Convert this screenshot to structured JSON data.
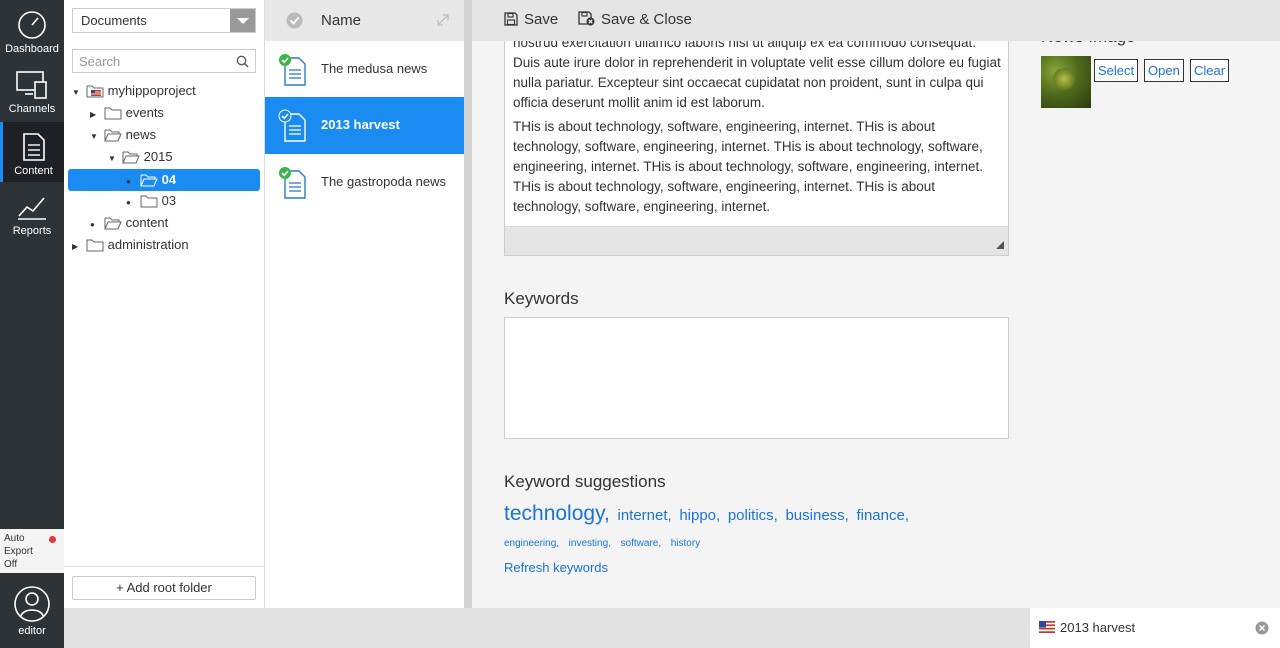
{
  "nav": {
    "items": [
      {
        "label": "Dashboard",
        "icon": "dashboard-icon"
      },
      {
        "label": "Channels",
        "icon": "channels-icon"
      },
      {
        "label": "Content",
        "icon": "content-icon",
        "active": true
      },
      {
        "label": "Reports",
        "icon": "reports-icon"
      }
    ],
    "auto_export": "Auto Export Off",
    "user": "editor"
  },
  "tree": {
    "dropdown_value": "Documents",
    "search_placeholder": "Search",
    "nodes": [
      {
        "label": "myhippoproject"
      },
      {
        "label": "events"
      },
      {
        "label": "news"
      },
      {
        "label": "2015"
      },
      {
        "label": "04",
        "selected": true
      },
      {
        "label": "03"
      },
      {
        "label": "content"
      },
      {
        "label": "administration"
      }
    ],
    "add_root_label": "+ Add root folder"
  },
  "list": {
    "header": "Name",
    "docs": [
      {
        "label": "The medusa news"
      },
      {
        "label": "2013 harvest",
        "selected": true
      },
      {
        "label": "The gastropoda news"
      }
    ]
  },
  "toolbar": {
    "save": "Save",
    "save_close": "Save & Close"
  },
  "editor": {
    "body_p1": "nostrud exercitation ullamco laboris nisi ut aliquip ex ea commodo consequat. Duis aute irure dolor in reprehenderit in voluptate velit esse cillum dolore eu fugiat nulla pariatur. Excepteur sint occaecat cupidatat non proident, sunt in culpa qui officia deserunt mollit anim id est laborum.",
    "body_p2": "THis is about technology, software, engineering, internet. THis is about technology, software, engineering, internet. THis is about technology, software, engineering, internet. THis is about technology, software, engineering, internet. THis is about technology, software, engineering, internet. THis is about technology, software, engineering, internet.",
    "keywords_label": "Keywords",
    "suggestions_label": "Keyword suggestions",
    "suggestions": [
      {
        "label": "technology,",
        "size": 21
      },
      {
        "label": "internet,",
        "size": 15
      },
      {
        "label": "hippo,",
        "size": 15
      },
      {
        "label": "politics,",
        "size": 15
      },
      {
        "label": "business,",
        "size": 15
      },
      {
        "label": "finance,",
        "size": 15
      },
      {
        "label": "engineering,",
        "size": 10
      },
      {
        "label": "investing,",
        "size": 10
      },
      {
        "label": "software,",
        "size": 10
      },
      {
        "label": "history",
        "size": 10
      }
    ],
    "refresh_label": "Refresh keywords",
    "news_image_label": "News Image",
    "image_buttons": {
      "select": "Select",
      "open": "Open",
      "clear": "Clear"
    }
  },
  "bottom_tab": {
    "label": "2013 harvest"
  },
  "colors": {
    "accent": "#1a8bf0",
    "link": "#1a73d9",
    "nav_bg": "#2e3338"
  }
}
